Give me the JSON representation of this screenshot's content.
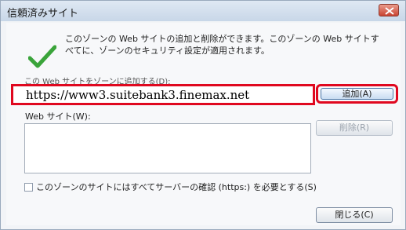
{
  "window": {
    "title": "信頼済みサイト",
    "close_icon": "close-icon"
  },
  "info": {
    "icon": "checkmark-icon",
    "line1": "このゾーンの Web サイトの追加と削除ができます。このゾーンの Web サイトす",
    "line2": "べてに、ゾーンのセキュリティ設定が適用されます。"
  },
  "add_section": {
    "label": "この Web サイトをゾーンに追加する(D):",
    "url_value": "https://www3.suitebank3.finemax.net",
    "add_button": "追加(A)"
  },
  "websites": {
    "label": "Web サイト(W):",
    "items": [],
    "remove_button": "削除(R)"
  },
  "https_option": {
    "label": "このゾーンのサイトにはすべてサーバーの確認 (https:) を必要とする(S)",
    "checked": false
  },
  "footer": {
    "close_button": "閉じる(C)"
  },
  "colors": {
    "highlight": "#e0081f",
    "check": "#3aa43a"
  }
}
